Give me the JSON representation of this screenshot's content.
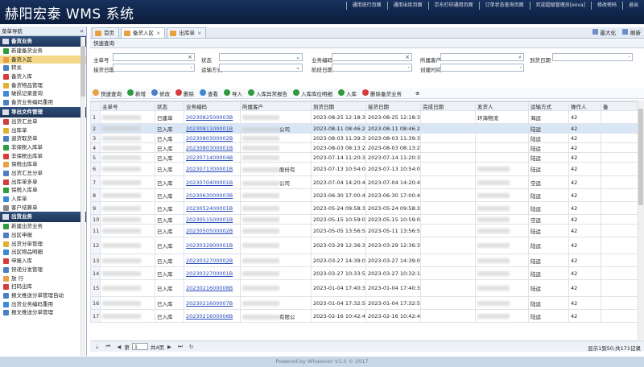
{
  "header": {
    "title": "赫阳宏泰 WMS 系统",
    "links": [
      "通用放行页面",
      "通用出库页面",
      "京东打印通用页面",
      "订单状态查询页面",
      "欢迎超级管理员[eova]",
      "修改密码",
      "退出"
    ]
  },
  "sidebar": {
    "title": "菜单导航",
    "collapse_icon": "«",
    "sections": [
      {
        "label": "备货业务",
        "items": [
          {
            "label": "新建备货业务",
            "color": "#2e9b3e"
          },
          {
            "label": "备货入区",
            "color": "#e8a040",
            "selected": true
          },
          {
            "label": "转关",
            "color": "#4a7fc1"
          },
          {
            "label": "备货入库",
            "color": "#d63b3b"
          },
          {
            "label": "备货物品管理",
            "color": "#e0b030"
          },
          {
            "label": "破损记录查询",
            "color": "#3a8ad6"
          },
          {
            "label": "备货业务编码重用",
            "color": "#4a7fc1"
          }
        ]
      },
      {
        "label": "导出文件管理",
        "items": [
          {
            "label": "出货汇总单",
            "color": "#d63b3b"
          },
          {
            "label": "出库单",
            "color": "#e0b030"
          },
          {
            "label": "退货取货单",
            "color": "#4a7fc1"
          },
          {
            "label": "非保税入库单",
            "color": "#2e9b3e"
          },
          {
            "label": "非保税出库单",
            "color": "#d63b3b"
          },
          {
            "label": "保税出库单",
            "color": "#e8a040"
          },
          {
            "label": "出货汇总分单",
            "color": "#4a7fc1"
          },
          {
            "label": "出库单多单",
            "color": "#d63b3b"
          },
          {
            "label": "保税入库单",
            "color": "#2e9b3e"
          },
          {
            "label": "入库单",
            "color": "#3a8ad6"
          },
          {
            "label": "客户结算单",
            "color": "#888888"
          }
        ]
      },
      {
        "label": "出货业务",
        "items": [
          {
            "label": "新建出货业务",
            "color": "#2e9b3e"
          },
          {
            "label": "出区申报",
            "color": "#4a7fc1"
          },
          {
            "label": "出货分单管理",
            "color": "#e0b030"
          },
          {
            "label": "出区物品明细",
            "color": "#3a8ad6"
          },
          {
            "label": "申报入库",
            "color": "#d63b3b"
          },
          {
            "label": "快递分发管理",
            "color": "#4a7fc1"
          },
          {
            "label": "放 行",
            "color": "#e8a040"
          },
          {
            "label": "扫码出库",
            "color": "#d63b3b"
          },
          {
            "label": "报文推送分单管理自动",
            "color": "#4a7fc1"
          },
          {
            "label": "出货业务编码重用",
            "color": "#3a8ad6"
          },
          {
            "label": "报文推送分单管理",
            "color": "#4a7fc1"
          }
        ]
      }
    ]
  },
  "tabs": [
    {
      "label": "首页",
      "active": false
    },
    {
      "label": "备货入区",
      "active": true
    },
    {
      "label": "出库单",
      "active": false
    }
  ],
  "tab_tools": [
    "最大化",
    "刷新"
  ],
  "query": {
    "title": "快速查询",
    "fields": {
      "order_no": "主单号",
      "status": "状态",
      "biz_code": "业务编码",
      "customer": "所属客户",
      "arrive_date": "到货日期",
      "receive_date": "接货日期",
      "transport": "运输方式",
      "flight_date": "航班日期",
      "created": "创建时间"
    },
    "buttons": [
      "快速查询",
      "新增",
      "修改",
      "删除",
      "查看",
      "导入",
      "入库异常报告",
      "入库库位明细",
      "入库",
      "删除备货业务"
    ]
  },
  "grid": {
    "columns": [
      "",
      "主单号",
      "状态",
      "业务编码",
      "所属客户",
      "到货日期",
      "接货日期",
      "完成日期",
      "发货人",
      "运输方式",
      "操作人",
      "备"
    ],
    "rows": [
      {
        "n": "1",
        "status": "已建单",
        "code": "2023082500003B",
        "cust": "",
        "arr": "2023-08-25 12:18:33",
        "rec": "2023-08-25 12:18:33",
        "sender": "环海物流",
        "trans": "海运",
        "op": "42"
      },
      {
        "n": "2",
        "status": "已入库",
        "code": "2023081100001B",
        "cust": "公司",
        "arr": "2023-08-11 08:46:22",
        "rec": "2023-08-11 08:46:22",
        "sender": "",
        "trans": "陆运",
        "op": "42"
      },
      {
        "n": "3",
        "status": "已入库",
        "code": "2023080300002B",
        "cust": "",
        "arr": "2023-08-03 11:39:31",
        "rec": "2023-08-03 11:39:31",
        "sender": "",
        "trans": "陆运",
        "op": "42"
      },
      {
        "n": "4",
        "status": "已入库",
        "code": "2023080300001B",
        "cust": "",
        "arr": "2023-08-03 08:13:22",
        "rec": "2023-08-03 08:13:22",
        "sender": "",
        "trans": "陆运",
        "op": "42"
      },
      {
        "n": "5",
        "status": "已入库",
        "code": "2023071400004B",
        "cust": "",
        "arr": "2023-07-14 11:20:39",
        "rec": "2023-07-14 11:20:39",
        "sender": "",
        "trans": "陆运",
        "op": "42"
      },
      {
        "n": "6",
        "status": "已入库",
        "code": "2023071300001B",
        "cust": "股份有",
        "arr": "2023-07-13 10:54:07",
        "rec": "2023-07-13 10:54:07",
        "sender": "",
        "trans": "陆运",
        "op": "42"
      },
      {
        "n": "7",
        "status": "已入库",
        "code": "2023070400001B",
        "cust": "公司",
        "arr": "2023-07-04 14:20:44",
        "rec": "2023-07-04 14:20:44",
        "sender": "",
        "trans": "空运",
        "op": "42"
      },
      {
        "n": "8",
        "status": "已入库",
        "code": "2023063000003B",
        "cust": "",
        "arr": "2023-06-30 17:00:47",
        "rec": "2023-06-30 17:00:47",
        "sender": "",
        "trans": "陆运",
        "op": "42"
      },
      {
        "n": "9",
        "status": "已入库",
        "code": "2023052400001B",
        "cust": "",
        "arr": "2023-05-24 09:58:30",
        "rec": "2023-05-24 09:58:30",
        "sender": "",
        "trans": "陆运",
        "op": "42"
      },
      {
        "n": "10",
        "status": "已入库",
        "code": "2023051500001B",
        "cust": "",
        "arr": "2023-05-15 10:59:00",
        "rec": "2023-05-15 10:59:00",
        "sender": "",
        "trans": "空运",
        "op": "42"
      },
      {
        "n": "11",
        "status": "已入库",
        "code": "2023050500002B",
        "cust": "",
        "arr": "2023-05-05 13:56:57",
        "rec": "2023-05-11 13:56:57",
        "sender": "",
        "trans": "陆运",
        "op": "42"
      },
      {
        "n": "12",
        "status": "已入库",
        "code": "2023032900001B",
        "cust": "",
        "arr": "2023-03-29 12:36:37",
        "rec": "2023-03-29 12:36:37",
        "sender": "",
        "trans": "陆运",
        "op": "42"
      },
      {
        "n": "13",
        "status": "已入库",
        "code": "2023032700002B",
        "cust": "",
        "arr": "2023-03-27 14:39:06",
        "rec": "2023-03-27 14:39:06",
        "sender": "",
        "trans": "陆运",
        "op": "42"
      },
      {
        "n": "14",
        "status": "已入库",
        "code": "2023032700001B",
        "cust": "",
        "arr": "2023-03-27 10:33:53",
        "rec": "2023-03-27 10:32:15",
        "sender": "",
        "trans": "陆运",
        "op": "42"
      },
      {
        "n": "15",
        "status": "已入库",
        "code": "2023021600008B",
        "cust": "",
        "arr": "2023-01-04 17:40:30",
        "rec": "2023-01-04 17:40:30",
        "sender": "",
        "trans": "陆运",
        "op": "42"
      },
      {
        "n": "16",
        "status": "已入库",
        "code": "2023021600007B",
        "cust": "",
        "arr": "2023-01-04 17:32:52",
        "rec": "2023-01-04 17:32:52",
        "sender": "",
        "trans": "陆运",
        "op": "42"
      },
      {
        "n": "17",
        "status": "已入库",
        "code": "2023021600006B",
        "cust": "有限公",
        "arr": "2023-02-16 10:42:41",
        "rec": "2023-02-16 10:42:41",
        "sender": "",
        "trans": "陆运",
        "op": "42"
      }
    ]
  },
  "pager": {
    "page": "1",
    "total_pages": "共4页",
    "info": "显示1到50,共171记录"
  },
  "footer": "Powered by Whatever V1.0 © 2017"
}
